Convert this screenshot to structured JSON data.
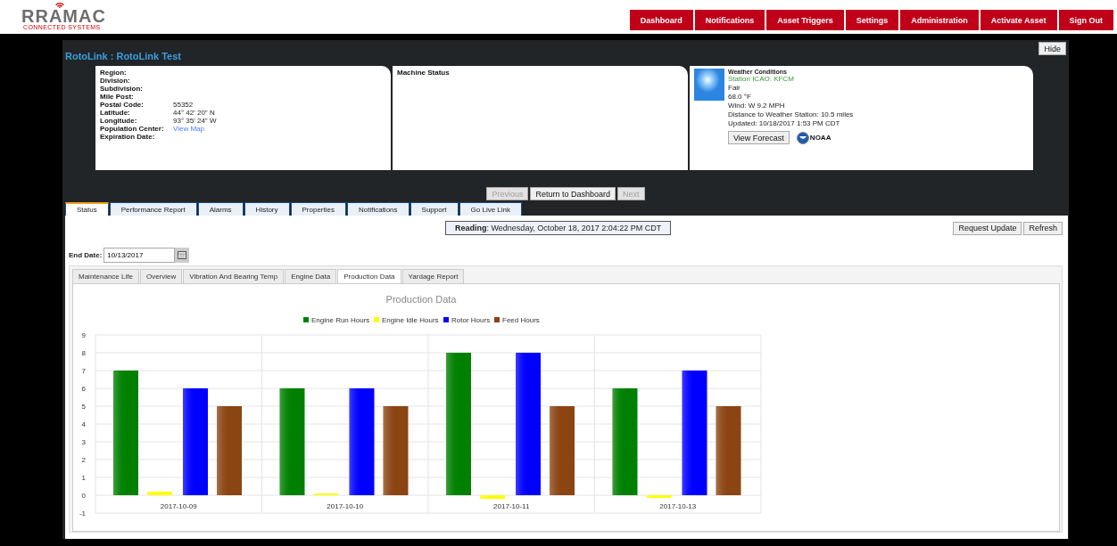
{
  "logo": {
    "name": "RRAMAC",
    "tagline": "CONNECTED SYSTEMS"
  },
  "nav": [
    "Dashboard",
    "Notifications",
    "Asset Triggers",
    "Settings",
    "Administration",
    "Activate Asset",
    "Sign Out"
  ],
  "panel": {
    "title": "RotoLink : RotoLink Test",
    "hide_button": "Hide"
  },
  "location": [
    {
      "label": "Region:"
    },
    {
      "label": "Division:"
    },
    {
      "label": "Subdivision:"
    },
    {
      "label": "Mile Post:"
    },
    {
      "label": "Postal Code:",
      "value": "55352",
      "kind": "text"
    },
    {
      "label": "Latitude:",
      "value": "44° 42' 20\" N",
      "kind": "text"
    },
    {
      "label": "Longitude:",
      "value": "93° 35' 24\" W",
      "kind": "text"
    },
    {
      "label": "Population Center:",
      "value": "View Map",
      "kind": "link"
    },
    {
      "label": "Expiration Date:"
    }
  ],
  "machine_status": {
    "title": "Machine Status"
  },
  "weather": {
    "title": "Weather Conditions",
    "lines": [
      {
        "text": "Station ICAO: KFCM",
        "kind": "station"
      },
      {
        "text": "Fair",
        "kind": "text"
      },
      {
        "text": "68.0 °F",
        "kind": "text"
      },
      {
        "text": "Wind: W 9.2 MPH",
        "kind": "text"
      },
      {
        "text": "Distance to Weather Station: 10.5 miles",
        "kind": "text"
      },
      {
        "text": "Updated: 10/18/2017 1:53 PM CDT",
        "kind": "text"
      }
    ],
    "forecast_button": "View Forecast",
    "noaa": "NOAA"
  },
  "pager": [
    {
      "label": "Previous",
      "disabled": true
    },
    {
      "label": "Return to Dashboard",
      "disabled": false
    },
    {
      "label": "Next",
      "disabled": true
    }
  ],
  "tabs": [
    {
      "label": "Status",
      "selected": true
    },
    {
      "label": "Performance Report",
      "selected": false
    },
    {
      "label": "Alarms",
      "selected": false
    },
    {
      "label": "History",
      "selected": false
    },
    {
      "label": "Properties",
      "selected": false
    },
    {
      "label": "Notifications",
      "selected": false
    },
    {
      "label": "Support",
      "selected": false
    },
    {
      "label": "Go Live Link",
      "selected": false
    }
  ],
  "reading": {
    "label": "Reading",
    "value": ": Wednesday, October 18, 2017 2:04:22 PM CDT"
  },
  "actions": [
    "Request Update",
    "Refresh"
  ],
  "end_date": {
    "label": "End Date:",
    "value": "10/13/2017"
  },
  "subtabs": [
    {
      "label": "Maintenance Life",
      "selected": false
    },
    {
      "label": "Overview",
      "selected": false
    },
    {
      "label": "Vibration And Bearing Temp",
      "selected": false
    },
    {
      "label": "Engine Data",
      "selected": false
    },
    {
      "label": "Production Data",
      "selected": true
    },
    {
      "label": "Yardage Report",
      "selected": false
    }
  ],
  "chart": {
    "chart_data": {
      "type": "bar",
      "title": "Production Data",
      "categories": [
        "2017-10-09",
        "2017-10-10",
        "2017-10-11",
        "2017-10-13"
      ],
      "series": [
        {
          "name": "Engine Run Hours",
          "color": "#008000",
          "values": [
            7,
            6,
            8,
            6
          ]
        },
        {
          "name": "Engine Idle Hours",
          "color": "#ffff00",
          "values": [
            0.2,
            0.1,
            -0.2,
            -0.15
          ]
        },
        {
          "name": "Rotor Hours",
          "color": "#0000ff",
          "values": [
            6,
            6,
            8,
            7
          ]
        },
        {
          "name": "Feed Hours",
          "color": "#8b4513",
          "values": [
            5,
            5,
            5,
            5
          ]
        }
      ],
      "grid": true,
      "legend": true,
      "ylim": [
        -1,
        9
      ],
      "yticks": [
        -1,
        0,
        1,
        2,
        3,
        4,
        5,
        6,
        7,
        8,
        9
      ]
    }
  }
}
